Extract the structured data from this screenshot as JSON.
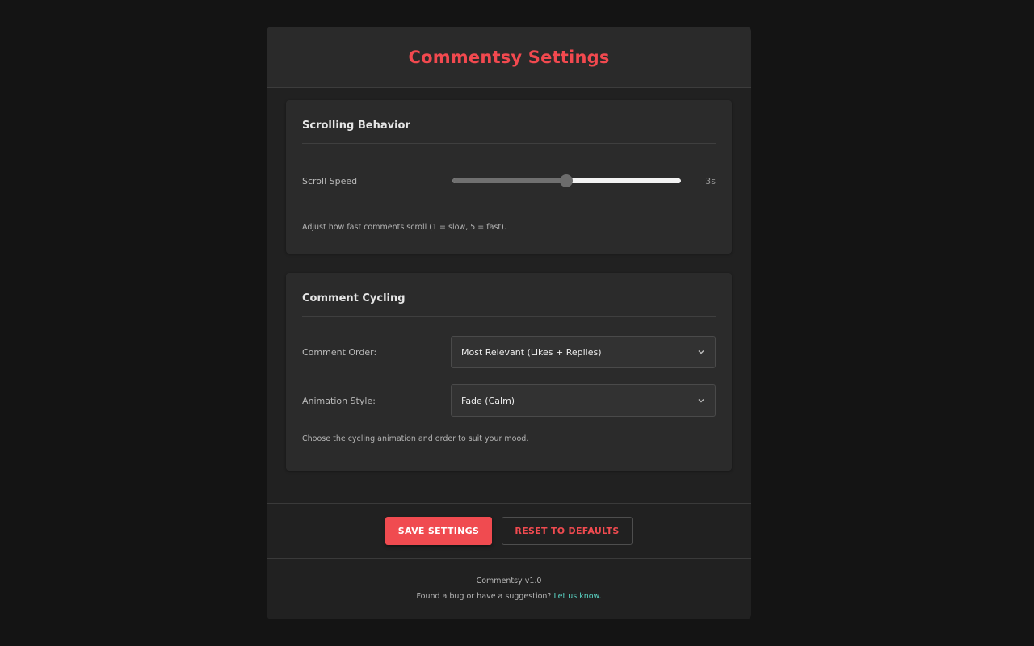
{
  "header": {
    "title": "Commentsy Settings"
  },
  "scrolling": {
    "title": "Scrolling Behavior",
    "speed_label": "Scroll Speed",
    "speed_value": "3s",
    "speed_level": 0.5,
    "help": "Adjust how fast comments scroll (1 = slow, 5 = fast)."
  },
  "cycling": {
    "title": "Comment Cycling",
    "order_label": "Comment Order:",
    "order_value": "Most Relevant (Likes + Replies)",
    "animation_label": "Animation Style:",
    "animation_value": "Fade (Calm)",
    "help": "Choose the cycling animation and order to suit your mood."
  },
  "actions": {
    "save_label": "SAVE SETTINGS",
    "reset_label": "RESET TO DEFAULTS"
  },
  "footer": {
    "version": "Commentsy v1.0",
    "feedback_text": "Found a bug or have a suggestion?",
    "feedback_link": "Let us know."
  },
  "colors": {
    "accent": "#f04b50",
    "link": "#5ad4c4",
    "background": "#141414",
    "panel": "#212121"
  },
  "icons": {
    "select_chevron": "chevron-down-icon"
  }
}
